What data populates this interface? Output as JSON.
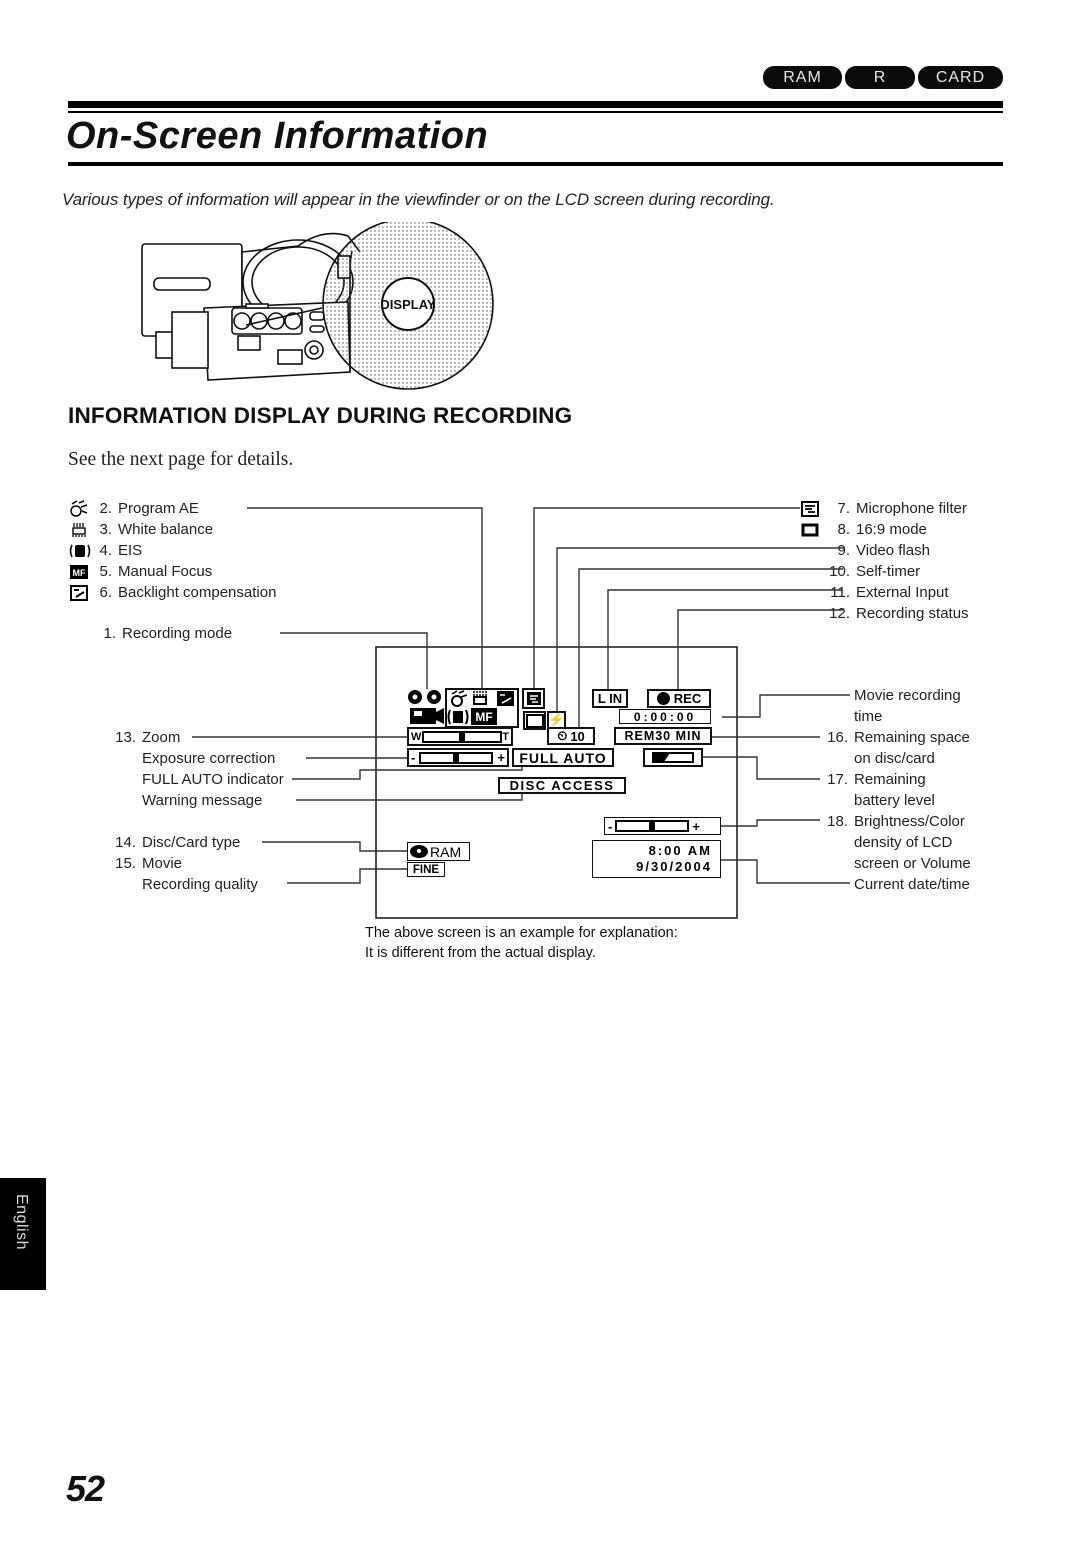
{
  "header": {
    "media_tabs": [
      "RAM",
      "R",
      "CARD"
    ],
    "title": "On-Screen Information",
    "intro": "Various types of information will appear in the viewfinder or on the LCD screen during recording."
  },
  "illustration": {
    "button_label": "DISPLAY"
  },
  "section": {
    "heading": "INFORMATION DISPLAY DURING RECORDING",
    "note": "See the next page for details."
  },
  "labels": {
    "left_top": [
      {
        "num": "2.",
        "text": "Program AE",
        "icon": "program-ae-icon"
      },
      {
        "num": "3.",
        "text": "White balance",
        "icon": "white-balance-icon"
      },
      {
        "num": "4.",
        "text": "EIS",
        "icon": "eis-icon"
      },
      {
        "num": "5.",
        "text": "Manual Focus",
        "icon": "manual-focus-icon"
      },
      {
        "num": "6.",
        "text": "Backlight compensation",
        "icon": "backlight-icon"
      }
    ],
    "recording_mode": {
      "num": "1.",
      "text": "Recording mode"
    },
    "right_top": [
      {
        "num": "7.",
        "text": "Microphone filter",
        "icon": "microphone-filter-icon"
      },
      {
        "num": "8.",
        "text": "16:9 mode",
        "icon": "wide-mode-icon"
      },
      {
        "num": "9.",
        "text": "Video flash"
      },
      {
        "num": "10.",
        "text": "Self-timer"
      },
      {
        "num": "11.",
        "text": "External Input"
      },
      {
        "num": "12.",
        "text": "Recording status"
      }
    ],
    "left_bottom": [
      {
        "num": "13.",
        "text": "Zoom"
      },
      {
        "num": "",
        "text": "Exposure correction"
      },
      {
        "num": "",
        "text": "FULL AUTO indicator"
      },
      {
        "num": "",
        "text": "Warning message"
      },
      {
        "num": "14.",
        "text": "Disc/Card type"
      },
      {
        "num": "15.",
        "text": "Movie"
      },
      {
        "num": "",
        "text": "Recording quality"
      }
    ],
    "right_bottom": [
      {
        "num": "",
        "text": "Movie recording"
      },
      {
        "num": "",
        "text": "time"
      },
      {
        "num": "16.",
        "text": "Remaining space"
      },
      {
        "num": "",
        "text": "on disc/card"
      },
      {
        "num": "17.",
        "text": "Remaining"
      },
      {
        "num": "",
        "text": "battery level"
      },
      {
        "num": "18.",
        "text": "Brightness/Color"
      },
      {
        "num": "",
        "text": "density of LCD"
      },
      {
        "num": "",
        "text": "screen or Volume"
      },
      {
        "num": "",
        "text": "Current date/time"
      }
    ]
  },
  "osd": {
    "zoom_wide": "W",
    "zoom_tele": "T",
    "zoom_position": 0.5,
    "exposure_minus": "-",
    "exposure_plus": "+",
    "exposure_level": 0.5,
    "full_auto": "FULL AUTO",
    "warning": "DISC ACCESS",
    "external_input": "L IN",
    "rec_status": "REC",
    "counter": "0:00:00",
    "self_timer": "10",
    "remaining": "REM30 MIN",
    "battery_level": 0.4,
    "manual_focus": "MF",
    "disc_type": "RAM",
    "quality": "FINE",
    "brightness_minus": "-",
    "brightness_plus": "+",
    "brightness_level": 0.5,
    "time": "8:00 AM",
    "date": "9/30/2004"
  },
  "caption": [
    "The above screen is an example for explanation:",
    "It is different from the actual display."
  ],
  "side_tab": "English",
  "page_number": "52"
}
